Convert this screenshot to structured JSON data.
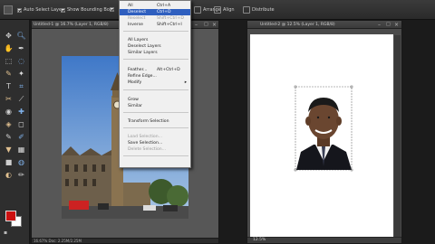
{
  "options_bar": {
    "auto_select_label": "Auto Select Layer",
    "show_bounding_label": "Show Bounding Box",
    "arrange_label": "Arrange",
    "align_label": "Align",
    "distribute_label": "Distribute"
  },
  "toolbox": {
    "tools": [
      "move-tool",
      "zoom-tool",
      "hand-tool",
      "eyedropper-tool",
      "marquee-tool",
      "lasso-tool",
      "quick-selection-tool",
      "magic-wand-tool",
      "type-tool",
      "crop-tool",
      "cookie-cutter-tool",
      "straighten-tool",
      "red-eye-tool",
      "healing-tool",
      "clone-stamp-tool",
      "eraser-tool",
      "brush-tool",
      "smart-brush-tool",
      "paint-bucket-tool",
      "gradient-tool",
      "shape-tool",
      "blur-tool",
      "sponge-tool",
      "pencil-tool"
    ],
    "foreground_color": "#cc1111",
    "background_color": "#ffffff"
  },
  "doc1": {
    "title": "Untitled-1 @ 16.7% (Layer 1, RGB/8)",
    "status": "16.67%  Doc: 2.25M/2.25M"
  },
  "doc2": {
    "title": "Untitled-2 @ 12.5% (Layer 1, RGB/8)",
    "zoom": "12.5%"
  },
  "select_menu": {
    "items": [
      {
        "label": "All",
        "shortcut": "Ctrl+A",
        "enabled": true
      },
      {
        "label": "Deselect",
        "shortcut": "Ctrl+D",
        "enabled": true,
        "highlighted": true
      },
      {
        "label": "Reselect",
        "shortcut": "Shift+Ctrl+D",
        "enabled": false
      },
      {
        "label": "Inverse",
        "shortcut": "Shift+Ctrl+I",
        "enabled": true
      },
      {
        "label": "All Layers",
        "shortcut": "",
        "enabled": true
      },
      {
        "label": "Deselect Layers",
        "shortcut": "",
        "enabled": true
      },
      {
        "label": "Similar Layers",
        "shortcut": "",
        "enabled": true
      },
      {
        "label": "Feather...",
        "shortcut": "Alt+Ctrl+D",
        "enabled": true
      },
      {
        "label": "Refine Edge...",
        "shortcut": "",
        "enabled": true
      },
      {
        "label": "Modify",
        "shortcut": "",
        "enabled": true,
        "submenu": true
      },
      {
        "label": "Grow",
        "shortcut": "",
        "enabled": true
      },
      {
        "label": "Similar",
        "shortcut": "",
        "enabled": true
      },
      {
        "label": "Transform Selection",
        "shortcut": "",
        "enabled": true
      },
      {
        "label": "Load Selection...",
        "shortcut": "",
        "enabled": false
      },
      {
        "label": "Save Selection...",
        "shortcut": "",
        "enabled": true
      },
      {
        "label": "Delete Selection...",
        "shortcut": "",
        "enabled": false
      }
    ]
  },
  "colors": {
    "menu_highlight": "#2f5fbf",
    "sky_top": "#3f78c8",
    "sky_bottom": "#a9c6e4"
  }
}
